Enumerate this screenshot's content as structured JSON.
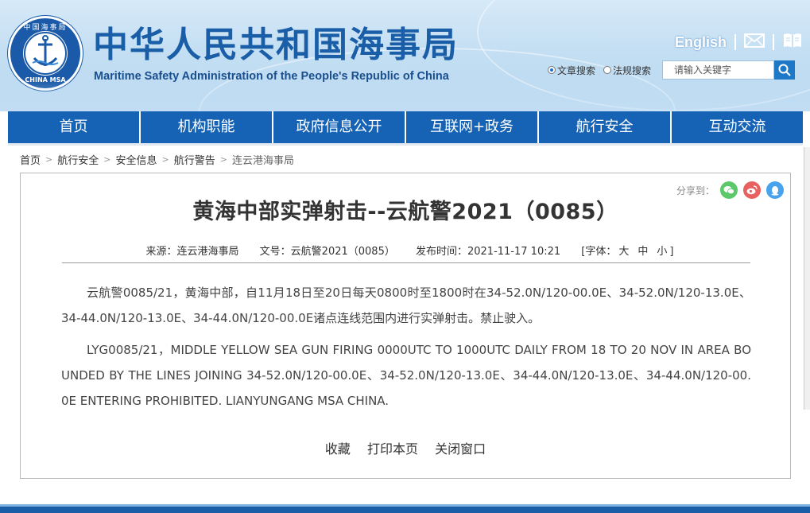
{
  "header": {
    "logo_top_text": "中国海事局",
    "logo_bottom_text": "CHINA MSA",
    "title": "中华人民共和国海事局",
    "subtitle": "Maritime Safety Administration of the People's Republic of China",
    "lang_link": "English",
    "icons": [
      "mail-icon",
      "book-icon"
    ]
  },
  "search": {
    "options": [
      "文章搜索",
      "法规搜索"
    ],
    "selected": "文章搜索",
    "placeholder": "请输入关键字"
  },
  "nav": {
    "items": [
      "首页",
      "机构职能",
      "政府信息公开",
      "互联网+政务",
      "航行安全",
      "互动交流"
    ],
    "color": "#1663b5"
  },
  "breadcrumb": [
    "首页",
    "航行安全",
    "安全信息",
    "航行警告",
    "连云港海事局"
  ],
  "article": {
    "share_label": "分享到：",
    "share_icons": [
      "wechat-icon",
      "weibo-icon",
      "qq-icon"
    ],
    "title": "黄海中部实弹射击--云航警2021（0085）",
    "meta": {
      "source": "来源：连云港海事局",
      "doc_no": "文号：云航警2021（0085）",
      "publish_time": "发布时间：2021-11-17 10:21",
      "font_label": "[字体：",
      "font_large": "大",
      "font_medium": "中",
      "font_small": "小",
      "font_end": "]"
    },
    "paragraphs": [
      "云航警0085/21，黄海中部，自11月18日至20日每天0800时至1800时在34-52.0N/120-00.0E、34-52.0N/120-13.0E、34-44.0N/120-13.0E、34-44.0N/120-00.0E诸点连线范围内进行实弹射击。禁止驶入。",
      "LYG0085/21，MIDDLE YELLOW SEA GUN FIRING 0000UTC TO 1000UTC DAILY FROM 18 TO 20 NOV IN AREA BOUNDED BY THE LINES JOINING 34-52.0N/120-00.0E、34-52.0N/120-13.0E、34-44.0N/120-13.0E、34-44.0N/120-00.0E ENTERING PROHIBITED. LIANYUNGANG MSA CHINA."
    ],
    "actions": [
      "收藏",
      "打印本页",
      "关闭窗口"
    ]
  }
}
